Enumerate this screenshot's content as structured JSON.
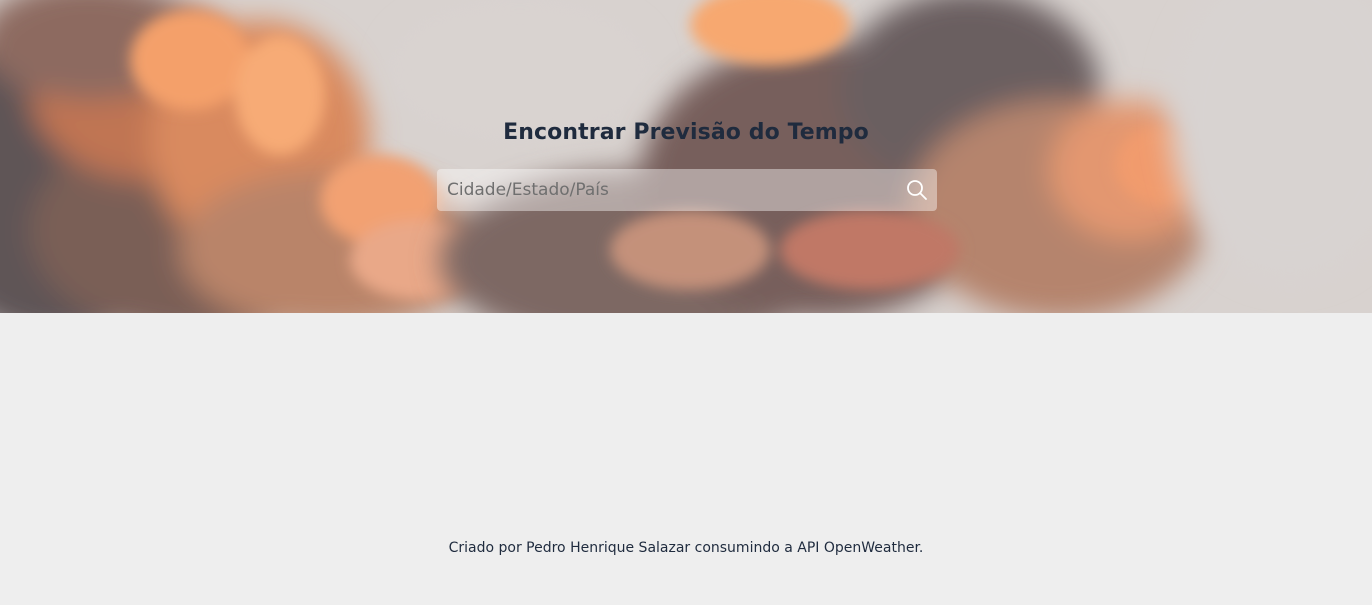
{
  "header": {
    "title": "Encontrar Previsão do Tempo"
  },
  "search": {
    "placeholder": "Cidade/Estado/País",
    "value": "",
    "button_icon": "search-icon"
  },
  "footer": {
    "credit": "Criado por Pedro Henrique Salazar consumindo a API OpenWeather."
  },
  "colors": {
    "page_background": "#eeeeee",
    "text_dark": "#1f2b3e",
    "cloud_orange": "#f0955a",
    "cloud_dark": "#6e5a5a"
  },
  "images": {
    "hero_background": "sunset-clouds"
  }
}
